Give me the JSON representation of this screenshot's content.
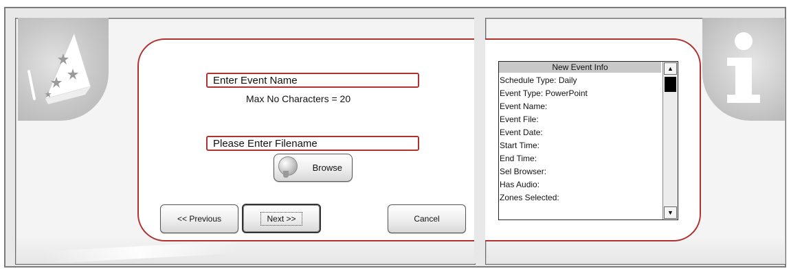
{
  "wizard": {
    "event_name_placeholder": "Enter Event Name",
    "max_chars_hint": "Max No Characters = 20",
    "filename_placeholder": "Please Enter Filename",
    "browse_label": "Browse",
    "previous_label": "<< Previous",
    "next_label": "Next >>",
    "cancel_label": "Cancel"
  },
  "info_panel": {
    "header": "New Event Info",
    "items": [
      "Schedule Type: Daily",
      "Event Type: PowerPoint",
      "Event Name:",
      "Event File:",
      "Event Date:",
      "Start Time:",
      "End Time:",
      "Sel Browser:",
      "Has Audio:",
      "Zones Selected:"
    ],
    "scroll_up": "▲",
    "scroll_down": "▼"
  },
  "icons": {
    "wizard": "wizard-hat-icon",
    "info": "info-icon"
  },
  "colors": {
    "accent": "#b03030",
    "panel_bg": "#f4f4f4",
    "frame_bg": "#e8e8e8"
  }
}
